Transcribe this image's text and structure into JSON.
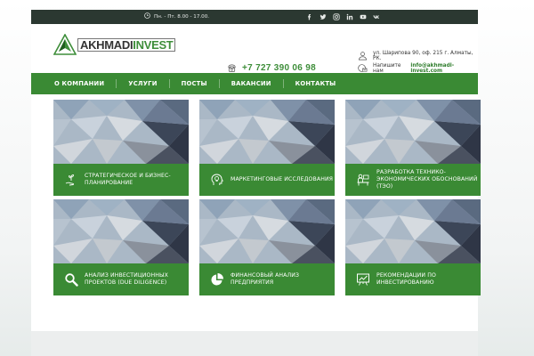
{
  "topbar": {
    "hours": "Пн. - Пт. 8.00 - 17.00.",
    "social": [
      "facebook-icon",
      "twitter-icon",
      "instagram-icon",
      "linkedin-icon",
      "youtube-icon",
      "vk-icon"
    ]
  },
  "logo": {
    "part1": "AKHMADI",
    "part2": "INVEST"
  },
  "header": {
    "phone": "+7 727 390 06 98",
    "address": "ул. Шарипова 90, оф. 215 г. Алматы, РК.",
    "email_prefix": "Напишите нам",
    "email": "info@akhmadi-invest.com"
  },
  "nav": {
    "items": [
      "О компании",
      "Услуги",
      "Посты",
      "Вакансии",
      "Контакты"
    ]
  },
  "services": [
    {
      "label": "Стратегическое и бизнес-планирование",
      "icon": "hand-plant-icon"
    },
    {
      "label": "Маркетинговые исследования",
      "icon": "lightbulb-head-icon"
    },
    {
      "label": "Разработка технико-экономических обоснований (ТЭО)",
      "icon": "person-desk-icon"
    },
    {
      "label": "Анализ инвестиционных проектов (due diligence)",
      "icon": "magnifier-icon"
    },
    {
      "label": "Финансовый анализ предприятия",
      "icon": "pie-chart-icon"
    },
    {
      "label": "Рекомендации по инвестированию",
      "icon": "presentation-board-icon"
    }
  ],
  "colors": {
    "brand_green": "#3a8a34",
    "topbar": "#2b3831",
    "accent_text_green": "#3e8e3a"
  }
}
